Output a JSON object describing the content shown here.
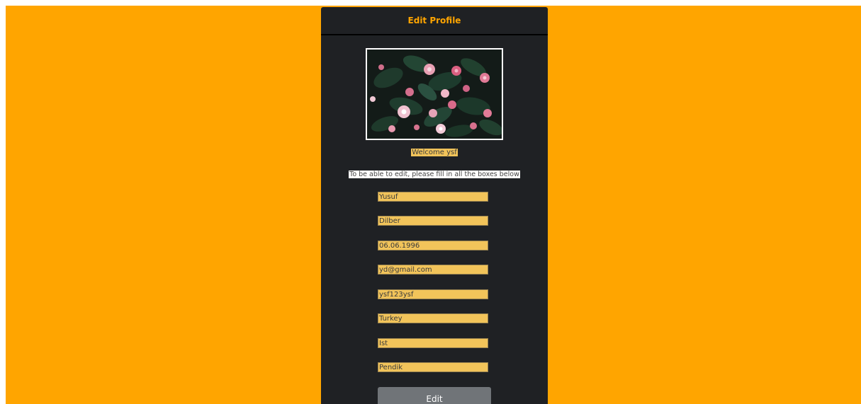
{
  "header": {
    "title": "Edit Profile"
  },
  "profile": {
    "photo_icon": "flower-photo"
  },
  "messages": {
    "welcome": "Welcome ysf",
    "instruction": "To be able to edit, please fill in all the boxes below"
  },
  "form": {
    "fields": [
      {
        "name": "first-name",
        "value": "Yusuf"
      },
      {
        "name": "last-name",
        "value": "Dilber"
      },
      {
        "name": "birth-date",
        "value": "06.06.1996"
      },
      {
        "name": "email",
        "value": "yd@gmail.com"
      },
      {
        "name": "password",
        "value": "ysf123ysf"
      },
      {
        "name": "country",
        "value": "Turkey"
      },
      {
        "name": "city",
        "value": "Ist"
      },
      {
        "name": "district",
        "value": "Pendik"
      }
    ],
    "submit_label": "Edit"
  },
  "colors": {
    "page_background": "#FFA500",
    "card_background": "#1f2124",
    "title_color": "#FFA500",
    "field_background": "#f2c45a",
    "button_background": "#707478"
  }
}
